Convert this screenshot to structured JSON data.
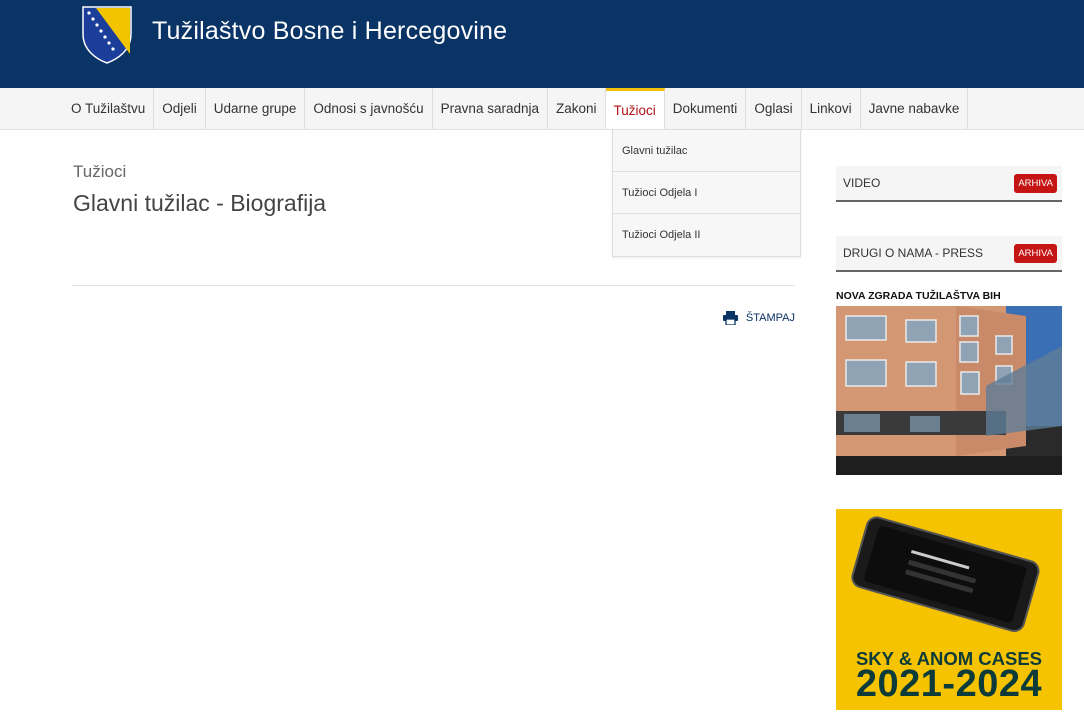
{
  "header": {
    "site_title": "Tužilaštvo Bosne i Hercegovine",
    "logo_icon": "bih-coat-of-arms-icon",
    "bg_color": "#0a3366"
  },
  "nav": {
    "items": [
      {
        "label": "O Tužilaštvu",
        "active": false
      },
      {
        "label": "Odjeli",
        "active": false
      },
      {
        "label": "Udarne grupe",
        "active": false
      },
      {
        "label": "Odnosi s javnošću",
        "active": false
      },
      {
        "label": "Pravna saradnja",
        "active": false
      },
      {
        "label": "Zakoni",
        "active": false
      },
      {
        "label": "Tužioci",
        "active": true
      },
      {
        "label": "Dokumenti",
        "active": false
      },
      {
        "label": "Oglasi",
        "active": false
      },
      {
        "label": "Linkovi",
        "active": false
      },
      {
        "label": "Javne nabavke",
        "active": false
      }
    ],
    "dropdown": [
      "Glavni tužilac",
      "Tužioci Odjela I",
      "Tužioci Odjela II"
    ]
  },
  "main": {
    "category": "Tužioci",
    "title": "Glavni tužilac - Biografija",
    "print_label": "ŠTAMPAJ",
    "print_icon": "printer-icon"
  },
  "sidebar": {
    "video_label": "VIDEO",
    "press_label": "DRUGI O NAMA - PRESS",
    "archive_label": "ARHIVA",
    "building_heading": "NOVA ZGRADA TUŽILAŠTVA BIH",
    "promo_line1": "SKY & ANOM CASES",
    "promo_line2": "2021-2024",
    "accent_color": "#c41414"
  }
}
